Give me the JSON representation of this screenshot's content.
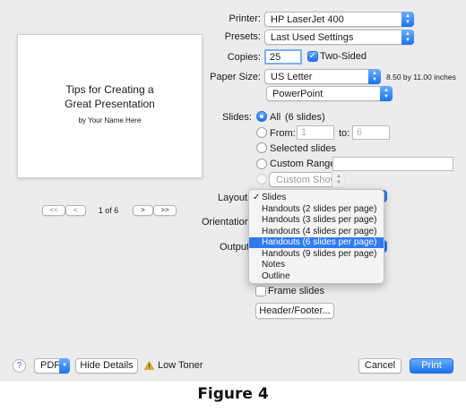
{
  "preview": {
    "title_line1": "Tips for Creating a",
    "title_line2": "Great Presentation",
    "subtitle": "by Your Name Here",
    "page_indicator": "1 of 6",
    "nav_first": "<<",
    "nav_prev": "<",
    "nav_next": ">",
    "nav_last": ">>"
  },
  "printer": {
    "label": "Printer:",
    "value": "HP LaserJet 400"
  },
  "presets": {
    "label": "Presets:",
    "value": "Last Used Settings"
  },
  "copies": {
    "label": "Copies:",
    "value": "25",
    "two_sided_label": "Two-Sided",
    "two_sided_checked": true
  },
  "paper_size": {
    "label": "Paper Size:",
    "value": "US Letter",
    "dimensions": "8.50 by 11.00 inches"
  },
  "app_section": {
    "value": "PowerPoint"
  },
  "slides": {
    "label": "Slides:",
    "all_label": "All",
    "all_count": "(6 slides)",
    "from_label": "From:",
    "from_value": "1",
    "to_label": "to:",
    "to_value": "6",
    "selected_label": "Selected slides",
    "custom_range_label": "Custom Range:",
    "custom_shows_value": "Custom Shows"
  },
  "layout": {
    "label": "Layout",
    "menu_items": [
      "Slides",
      "Handouts (2 slides per page)",
      "Handouts (3 slides per page)",
      "Handouts (4 slides per page)",
      "Handouts (6 slides per page)",
      "Handouts (9 slides per page)",
      "Notes",
      "Outline"
    ],
    "checked_item": "Slides",
    "highlighted_item": "Handouts (6 slides per page)"
  },
  "orientation": {
    "label": "Orientation"
  },
  "output": {
    "label": "Output"
  },
  "frame_slides": {
    "label": "Frame slides"
  },
  "header_footer": {
    "label": "Header/Footer..."
  },
  "bottom_bar": {
    "help": "?",
    "pdf": "PDF",
    "hide_details": "Hide Details",
    "warning": "Low Toner",
    "cancel": "Cancel",
    "print": "Print"
  },
  "caption": "Figure 4",
  "colors": {
    "accent": "#1a74ee",
    "highlight": "#2f7bf0",
    "warning": "#e0b020"
  }
}
